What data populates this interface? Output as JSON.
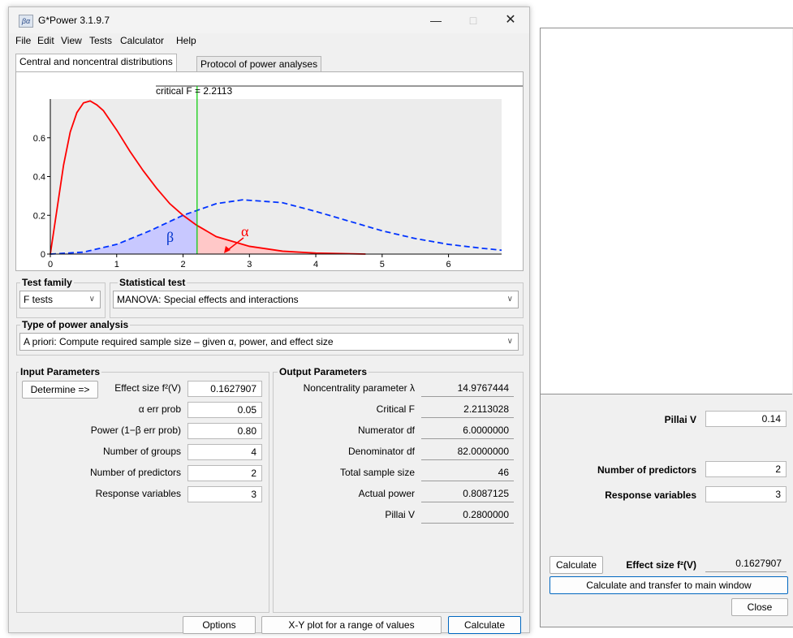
{
  "window": {
    "title": "G*Power 3.1.9.7",
    "icon_text": "βα"
  },
  "menu": [
    "File",
    "Edit",
    "View",
    "Tests",
    "Calculator",
    "Help"
  ],
  "tabs": [
    "Central and noncentral distributions",
    "Protocol of power analyses"
  ],
  "plot": {
    "critical_label": "critical F = 2.2113",
    "beta_symbol": "β",
    "alpha_symbol": "α",
    "x_ticks": [
      "0",
      "1",
      "2",
      "3",
      "4",
      "5",
      "6"
    ],
    "y_ticks": [
      "0",
      "0.2",
      "0.4",
      "0.6"
    ]
  },
  "chart_data": {
    "type": "line",
    "xlim": [
      0,
      6.8
    ],
    "ylim": [
      0,
      0.8
    ],
    "critical_x": 2.2113,
    "series": [
      {
        "style": "solid",
        "color": "#ff0000",
        "x": [
          0,
          0.1,
          0.2,
          0.3,
          0.4,
          0.5,
          0.6,
          0.7,
          0.8,
          1.0,
          1.2,
          1.4,
          1.6,
          1.8,
          2.0,
          2.2,
          2.5,
          3.0,
          3.5,
          4.0,
          4.75
        ],
        "y": [
          0,
          0.23,
          0.46,
          0.63,
          0.73,
          0.78,
          0.79,
          0.77,
          0.74,
          0.64,
          0.53,
          0.43,
          0.34,
          0.26,
          0.2,
          0.15,
          0.09,
          0.04,
          0.015,
          0.005,
          0
        ]
      },
      {
        "style": "dashed",
        "color": "#0033ff",
        "x": [
          0,
          0.5,
          1.0,
          1.5,
          2.0,
          2.5,
          2.9,
          3.5,
          4.0,
          4.5,
          5.0,
          5.5,
          6.0,
          6.5,
          6.8
        ],
        "y": [
          0,
          0.01,
          0.05,
          0.12,
          0.2,
          0.26,
          0.28,
          0.265,
          0.22,
          0.17,
          0.12,
          0.08,
          0.05,
          0.03,
          0.02
        ]
      }
    ]
  },
  "test_family": {
    "label": "Test family",
    "value": "F tests"
  },
  "statistical_test": {
    "label": "Statistical test",
    "value": "MANOVA: Special effects and interactions"
  },
  "analysis_type": {
    "label": "Type of power analysis",
    "value": "A priori: Compute required sample size – given α, power, and effect size"
  },
  "input": {
    "title": "Input Parameters",
    "determine": "Determine =>",
    "rows": [
      {
        "label": "Effect size f²(V)",
        "value": "0.1627907"
      },
      {
        "label": "α err prob",
        "value": "0.05"
      },
      {
        "label": "Power (1−β err prob)",
        "value": "0.80"
      },
      {
        "label": "Number of groups",
        "value": "4"
      },
      {
        "label": "Number of predictors",
        "value": "2"
      },
      {
        "label": "Response variables",
        "value": "3"
      }
    ]
  },
  "output": {
    "title": "Output Parameters",
    "rows": [
      {
        "label": "Noncentrality parameter λ",
        "value": "14.9767444"
      },
      {
        "label": "Critical F",
        "value": "2.2113028"
      },
      {
        "label": "Numerator df",
        "value": "6.0000000"
      },
      {
        "label": "Denominator df",
        "value": "82.0000000"
      },
      {
        "label": "Total sample size",
        "value": "46"
      },
      {
        "label": "Actual power",
        "value": "0.8087125"
      },
      {
        "label": "Pillai V",
        "value": "0.2800000"
      }
    ]
  },
  "buttons": {
    "options": "Options",
    "xy_plot": "X-Y plot for a range of values",
    "calculate": "Calculate"
  },
  "side": {
    "pillai_label": "Pillai V",
    "pillai_value": "0.14",
    "predictors_label": "Number of predictors",
    "predictors_value": "2",
    "response_label": "Response variables",
    "response_value": "3",
    "calculate": "Calculate",
    "effect_label": "Effect size f²(V)",
    "effect_value": "0.1627907",
    "transfer": "Calculate and transfer to main window",
    "close": "Close"
  }
}
